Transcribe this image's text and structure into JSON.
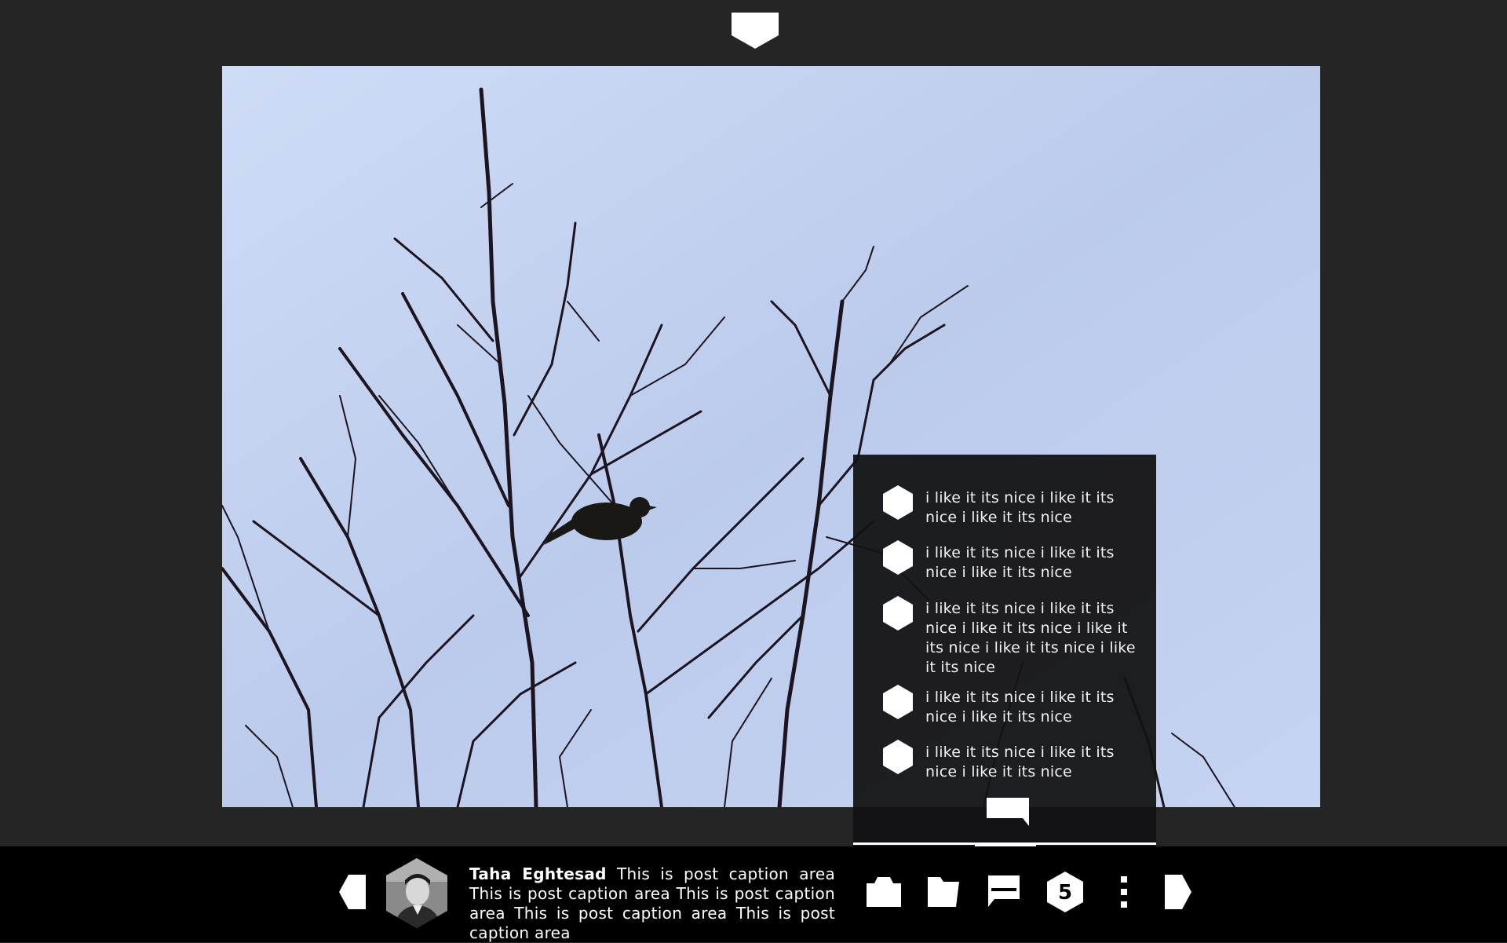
{
  "top": {
    "toggle_icon": "chevron-down-icon"
  },
  "post": {
    "author": "Taha Eghtesad",
    "caption": "This is post caption area This is post caption area This is post caption area This is post caption area This is post caption area"
  },
  "comments": [
    {
      "text": "i like it its nice i like it its nice i like it its nice"
    },
    {
      "text": "i like it its nice i like it its nice i like it its nice"
    },
    {
      "text": "i like it its nice i like it its nice i like it its nice i like it its nice i like it its nice i like it its nice"
    },
    {
      "text": "i like it its nice i like it its nice i like it its nice"
    },
    {
      "text": "i like it its nice i like it its nice i like it its nice"
    }
  ],
  "toolbar": {
    "count": "5",
    "icons": [
      "arrow-left-icon",
      "camera-icon",
      "folder-icon",
      "comment-icon",
      "count-badge",
      "more-vertical-icon",
      "arrow-right-icon"
    ]
  },
  "colors": {
    "background": "#252525",
    "bar": "#000000",
    "panel": "#121214",
    "sky": "#c2d0ef"
  }
}
